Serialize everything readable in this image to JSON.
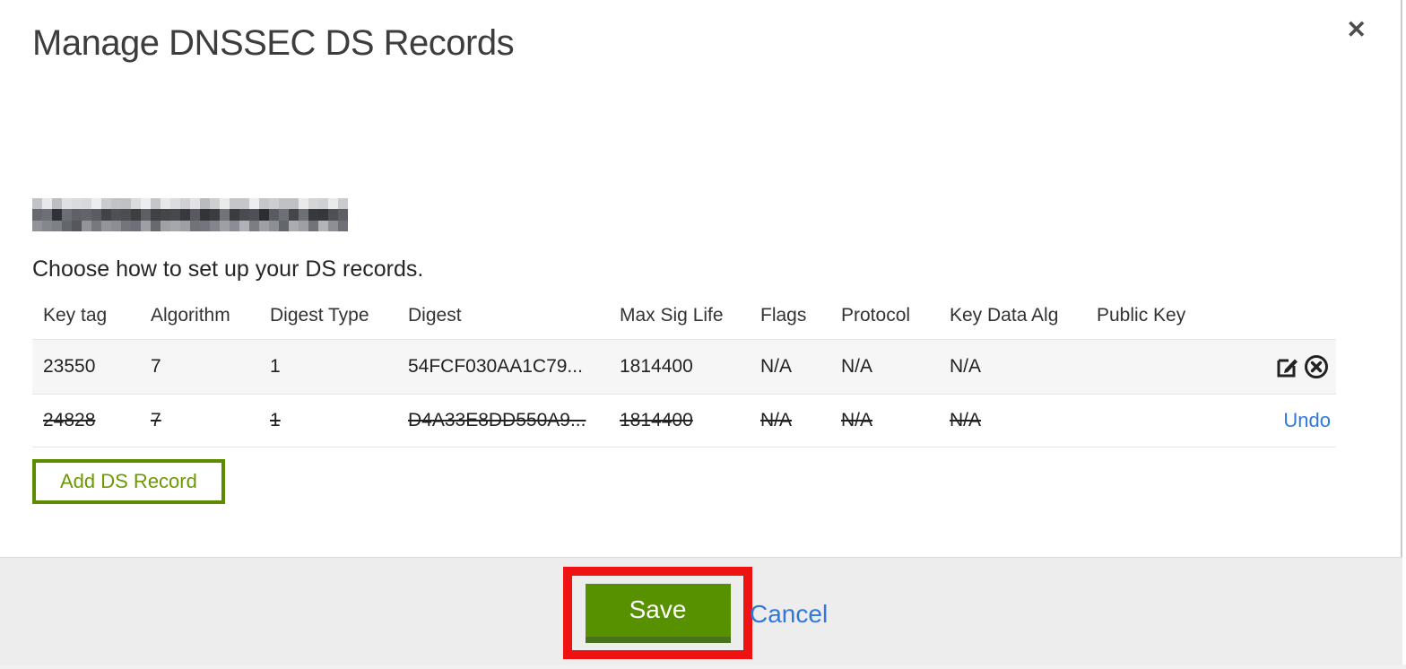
{
  "dialog": {
    "title": "Manage DNSSEC DS Records",
    "instruction": "Choose how to set up your DS records."
  },
  "table": {
    "columns": [
      "Key tag",
      "Algorithm",
      "Digest Type",
      "Digest",
      "Max Sig Life",
      "Flags",
      "Protocol",
      "Key Data Alg",
      "Public Key"
    ],
    "rows": [
      {
        "key_tag": "23550",
        "algorithm": "7",
        "digest_type": "1",
        "digest": "54FCF030AA1C79...",
        "max_sig_life": "1814400",
        "flags": "N/A",
        "protocol": "N/A",
        "key_data_alg": "N/A",
        "public_key": "",
        "state": "active",
        "actions": [
          "edit",
          "delete"
        ]
      },
      {
        "key_tag": "24828",
        "algorithm": "7",
        "digest_type": "1",
        "digest": "D4A33E8DD550A9...",
        "max_sig_life": "1814400",
        "flags": "N/A",
        "protocol": "N/A",
        "key_data_alg": "N/A",
        "public_key": "",
        "state": "deleted",
        "undo_label": "Undo"
      }
    ],
    "add_button_label": "Add DS Record"
  },
  "footer": {
    "save_label": "Save",
    "cancel_label": "Cancel"
  },
  "colors": {
    "accent_green": "#579100",
    "accent_green_dark": "#49721c",
    "outline_green": "#5d8b00",
    "link_blue": "#2f78e0",
    "annotation_red": "#ee1212",
    "footer_bg": "#ededed",
    "active_row_bg": "#f6f6f6"
  }
}
